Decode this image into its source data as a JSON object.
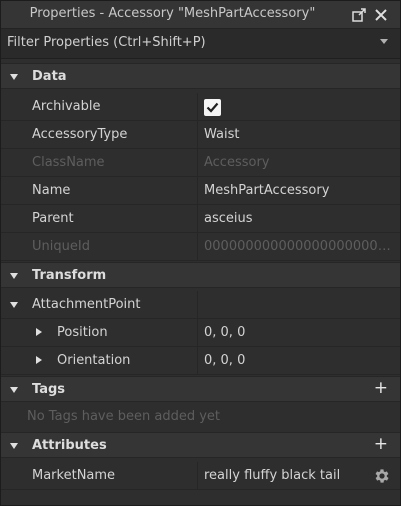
{
  "window": {
    "title": "Properties - Accessory \"MeshPartAccessory\""
  },
  "filter": {
    "placeholder": "Filter Properties (Ctrl+Shift+P)"
  },
  "sections": {
    "data": {
      "label": "Data"
    },
    "transform": {
      "label": "Transform"
    },
    "tags": {
      "label": "Tags",
      "empty_text": "No Tags have been added yet"
    },
    "attributes": {
      "label": "Attributes"
    }
  },
  "data_props": {
    "archivable": {
      "name": "Archivable",
      "checked": true
    },
    "accessory_type": {
      "name": "AccessoryType",
      "value": "Waist"
    },
    "class_name": {
      "name": "ClassName",
      "value": "Accessory"
    },
    "name": {
      "name": "Name",
      "value": "MeshPartAccessory"
    },
    "parent": {
      "name": "Parent",
      "value": "asceius"
    },
    "unique_id": {
      "name": "UniqueId",
      "value": "0000000000000000000000000000"
    }
  },
  "transform_props": {
    "attachment_point": {
      "name": "AttachmentPoint"
    },
    "position": {
      "name": "Position",
      "value": "0, 0, 0"
    },
    "orientation": {
      "name": "Orientation",
      "value": "0, 0, 0"
    }
  },
  "attributes": [
    {
      "name": "MarketName",
      "value": "really fluffy black tail"
    }
  ],
  "icons": {
    "undock": "undock-icon",
    "close": "close-icon",
    "gear": "gear-icon"
  }
}
